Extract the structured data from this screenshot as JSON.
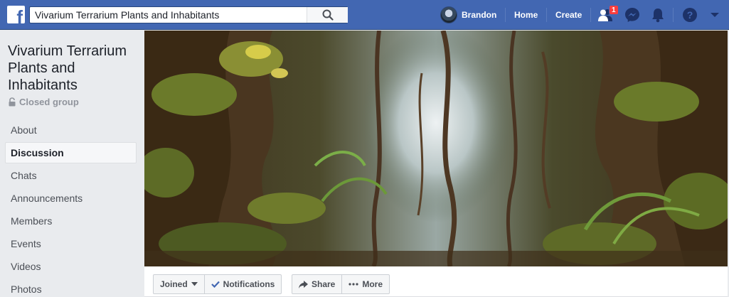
{
  "topbar": {
    "logo": "f",
    "search_value": "Vivarium Terrarium Plants and Inhabitants",
    "search_icon": "search-icon",
    "user_name": "Brandon",
    "home_label": "Home",
    "create_label": "Create",
    "friend_requests_badge": "1",
    "icons": [
      "friends-icon",
      "messenger-icon",
      "bell-icon",
      "help-icon",
      "chevron-down-icon"
    ],
    "brand_color": "#4267b2"
  },
  "group": {
    "title": "Vivarium Terrarium Plants and Inhabitants",
    "privacy": "Closed group"
  },
  "sidebar": {
    "items": [
      {
        "label": "About"
      },
      {
        "label": "Discussion",
        "active": true
      },
      {
        "label": "Chats"
      },
      {
        "label": "Announcements"
      },
      {
        "label": "Members"
      },
      {
        "label": "Events"
      },
      {
        "label": "Videos"
      },
      {
        "label": "Photos"
      }
    ]
  },
  "actions": {
    "joined_label": "Joined",
    "notifications_label": "Notifications",
    "share_label": "Share",
    "more_label": "More"
  }
}
